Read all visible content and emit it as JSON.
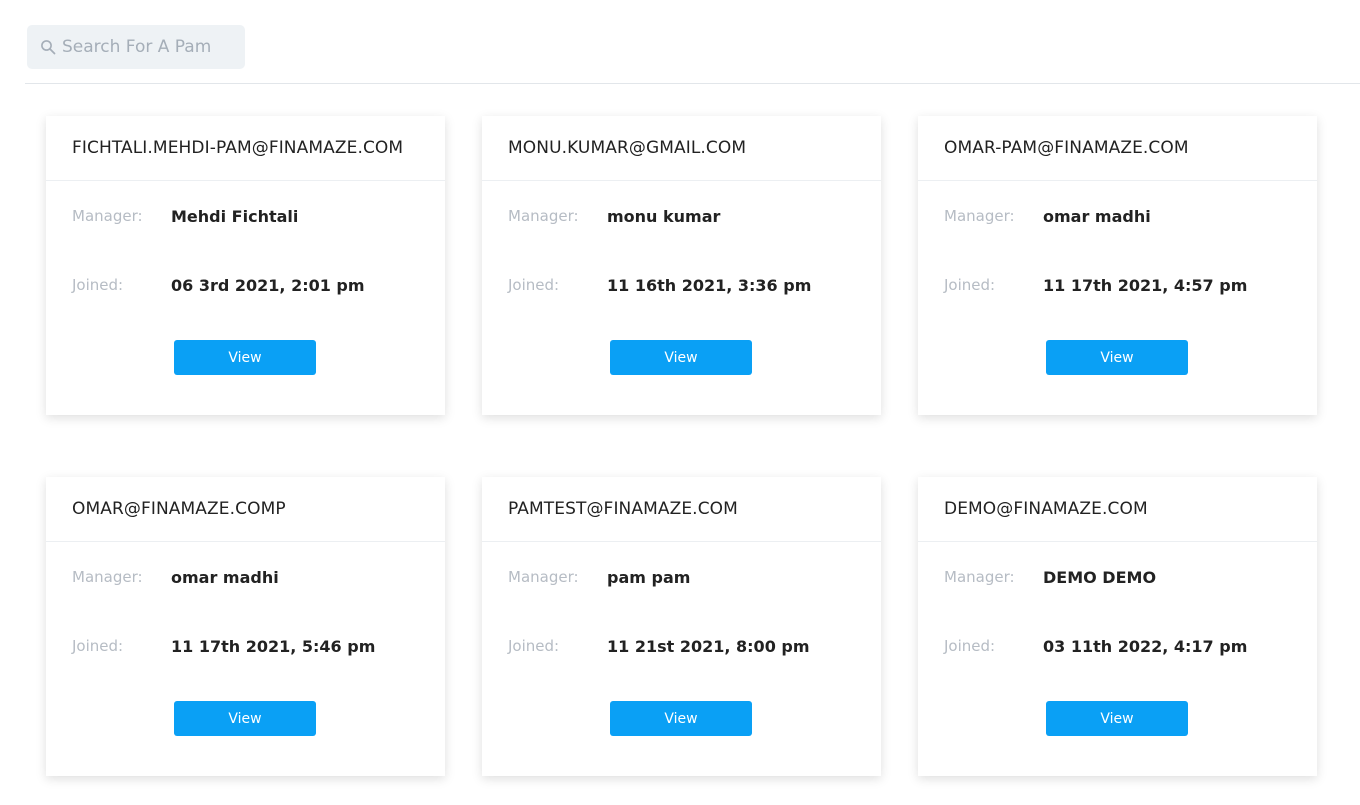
{
  "search": {
    "placeholder": "Search For A Pam",
    "value": ""
  },
  "cards": [
    {
      "title": "FICHTALI.MEHDI-PAM@FINAMAZE.COM",
      "manager_label": "Manager:",
      "manager": "Mehdi Fichtali",
      "joined_label": "Joined:",
      "joined": "06 3rd 2021, 2:01 pm",
      "button_label": "View"
    },
    {
      "title": "MONU.KUMAR@GMAIL.COM",
      "manager_label": "Manager:",
      "manager": "monu kumar",
      "joined_label": "Joined:",
      "joined": "11 16th 2021, 3:36 pm",
      "button_label": "View"
    },
    {
      "title": "OMAR-PAM@FINAMAZE.COM",
      "manager_label": "Manager:",
      "manager": "omar madhi",
      "joined_label": "Joined:",
      "joined": "11 17th 2021, 4:57 pm",
      "button_label": "View"
    },
    {
      "title": "OMAR@FINAMAZE.COMP",
      "manager_label": "Manager:",
      "manager": "omar madhi",
      "joined_label": "Joined:",
      "joined": "11 17th 2021, 5:46 pm",
      "button_label": "View"
    },
    {
      "title": "PAMTEST@FINAMAZE.COM",
      "manager_label": "Manager:",
      "manager": "pam pam",
      "joined_label": "Joined:",
      "joined": "11 21st 2021, 8:00 pm",
      "button_label": "View"
    },
    {
      "title": "DEMO@FINAMAZE.COM",
      "manager_label": "Manager:",
      "manager": "DEMO DEMO",
      "joined_label": "Joined:",
      "joined": "03 11th 2022, 4:17 pm",
      "button_label": "View"
    }
  ],
  "colors": {
    "accent": "#0aa0f5",
    "search_bg": "#eef2f5",
    "label_gray": "#b6bcc4"
  }
}
